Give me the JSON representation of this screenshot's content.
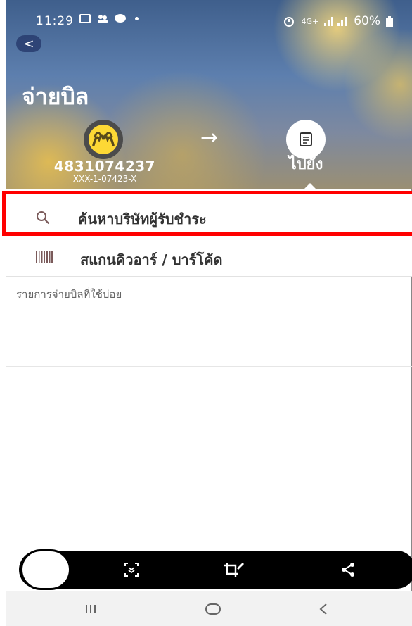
{
  "status_bar": {
    "time": "11:29",
    "battery": "60%",
    "network": "4G+"
  },
  "header": {
    "back_label": "<",
    "title": "จ่ายบิล",
    "from_account_number": "4831074237",
    "from_account_masked": "XXX-1-07423-X",
    "arrow": "→",
    "to_label": "ไปยัง"
  },
  "options": {
    "search_label": "ค้นหาบริษัทผู้รับชำระ",
    "scan_label": "สแกนคิวอาร์ / บาร์โค้ด"
  },
  "favorites": {
    "title": "รายการจ่ายบิลที่ใช้บ่อย"
  },
  "colors": {
    "highlight": "#ff0000",
    "bank_logo": "#fdd835",
    "hero_blue": "#4a6a98"
  },
  "icons": {
    "search": "search-icon",
    "scan": "barcode-icon",
    "bill": "bill-icon",
    "bank": "krungsri-logo-icon"
  }
}
